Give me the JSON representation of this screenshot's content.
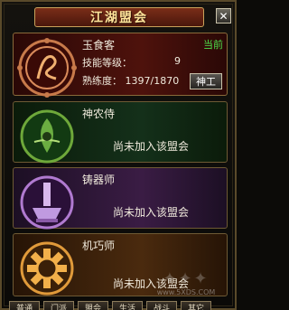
{
  "window": {
    "title": "江湖盟会"
  },
  "titlebar": {
    "help_label": "?",
    "close_label": "✕"
  },
  "guilds": [
    {
      "name": "玉食客",
      "icon": "chef-emblem-icon",
      "badge": "当前",
      "level_label": "技能等级：",
      "level_value": "9",
      "proficiency_label": "熟练度：",
      "proficiency_value": "1397/1870",
      "rank_button": "神工",
      "accent": "#c0392b"
    },
    {
      "name": "神农侍",
      "icon": "leaf-emblem-icon",
      "status": "尚未加入该盟会",
      "accent": "#4caf50"
    },
    {
      "name": "铸器师",
      "icon": "forge-emblem-icon",
      "status": "尚未加入该盟会",
      "accent": "#9b59b6"
    },
    {
      "name": "机巧师",
      "icon": "gear-emblem-icon",
      "status": "尚未加入该盟会",
      "accent": "#e67e22"
    }
  ],
  "bottom_tabs": [
    "普通",
    "门派",
    "盟会",
    "生活",
    "战斗",
    "其它"
  ],
  "watermark": {
    "text": "www.5XDS.COM"
  }
}
